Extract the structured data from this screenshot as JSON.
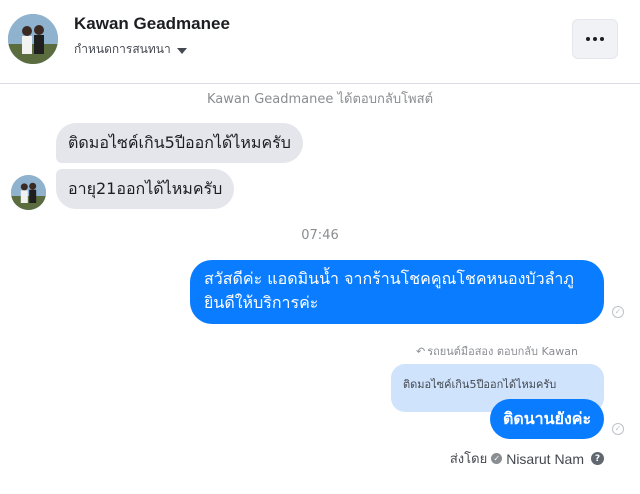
{
  "header": {
    "name": "Kawan Geadmanee",
    "subtitle": "กำหนดการสนทนา",
    "more_icon": "more-horizontal-icon"
  },
  "thread": {
    "reply_note": "Kawan Geadmanee ได้ตอบกลับโพสต์",
    "incoming": [
      "ติดมอไซค์เกิน5ปีออกได้ไหมครับ",
      "อายุ21ออกได้ไหมครับ"
    ],
    "time": "07:46",
    "outgoing_1": {
      "line1": "สวัสดีค่ะ แอดมินน้ำ จากร้านโชคคูณโชคหนองบัวลำภู",
      "line2": "ยินดีให้บริการค่ะ"
    },
    "reply_label": "รถยนต์มือสอง ตอบกลับ Kawan",
    "quoted": "ติดมอไซค์เกิน5ปีออกได้ไหมครับ",
    "outgoing_2": "ติดนานยังค่ะ",
    "sent_by_prefix": "ส่งโดย",
    "sent_by_name": "Nisarut Nam"
  },
  "colors": {
    "accent": "#0a7cff",
    "incoming_bubble": "#e4e6eb",
    "quoted_bubble": "#cfe3fd",
    "muted_text": "#8a8d91"
  }
}
